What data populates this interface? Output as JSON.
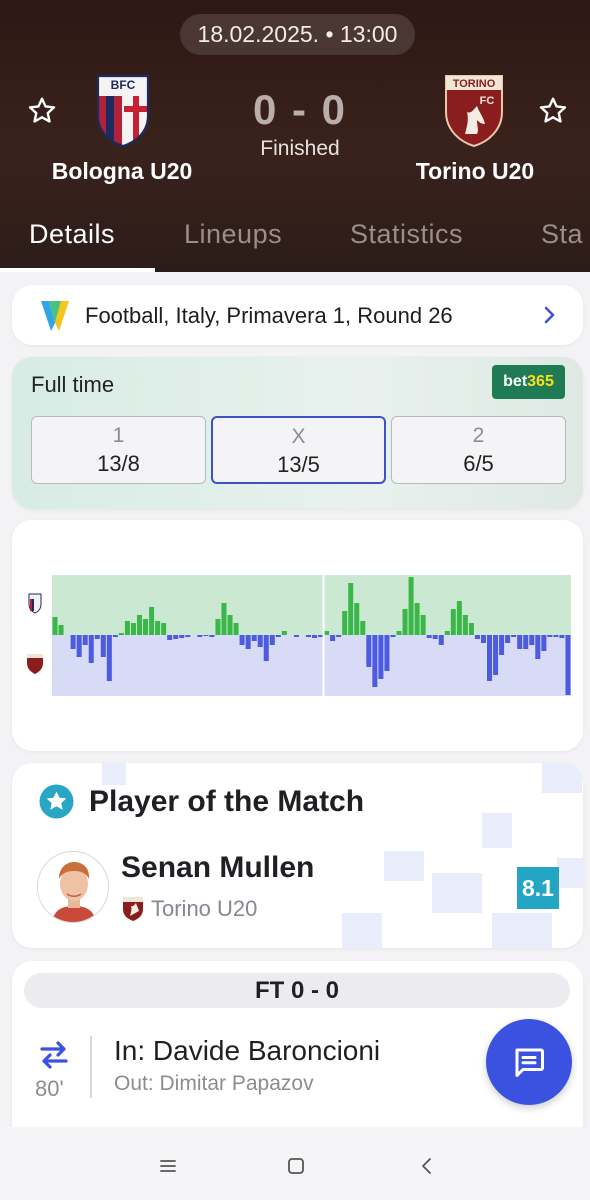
{
  "match": {
    "datetime": "18.02.2025. • 13:00",
    "home_team": "Bologna U20",
    "away_team": "Torino U20",
    "score": "0 - 0",
    "status": "Finished"
  },
  "tabs": [
    "Details",
    "Lineups",
    "Statistics",
    "Sta"
  ],
  "tournament": {
    "label": "Football, Italy, Primavera 1, Round 26"
  },
  "odds": {
    "title": "Full time",
    "bookmaker_prefix": "bet",
    "bookmaker_suffix": "365",
    "options": [
      {
        "key": "1",
        "value": "13/8"
      },
      {
        "key": "X",
        "value": "13/5"
      },
      {
        "key": "2",
        "value": "6/5"
      }
    ]
  },
  "momentum": {
    "home_color": "#3bb74a",
    "away_color": "#4c5bdf",
    "values": [
      18,
      10,
      0,
      -14,
      -22,
      -10,
      -28,
      -4,
      -22,
      -46,
      -2,
      2,
      14,
      12,
      20,
      16,
      28,
      14,
      12,
      -5,
      -4,
      -3,
      -2,
      0,
      -2,
      -1,
      -2,
      16,
      32,
      20,
      12,
      -10,
      -14,
      -6,
      -12,
      -26,
      -10,
      -2,
      4,
      0,
      -2,
      0,
      -2,
      -3,
      -2,
      4,
      -6,
      -2,
      24,
      52,
      32,
      14,
      -32,
      -52,
      -44,
      -36,
      -2,
      4,
      26,
      58,
      32,
      20,
      -3,
      -4,
      -10,
      4,
      26,
      34,
      20,
      12,
      -4,
      -8,
      -46,
      -40,
      -20,
      -8,
      -2,
      -14,
      -14,
      -10,
      -24,
      -16,
      -2,
      -2,
      -3,
      -60
    ],
    "split_index": 45
  },
  "potm": {
    "heading": "Player of the Match",
    "player": "Senan Mullen",
    "team": "Torino U20",
    "rating": "8.1",
    "rating_color": "#23a6c4"
  },
  "events": {
    "ft_label": "FT 0 - 0",
    "items": [
      {
        "minute": "80'",
        "in": "In: Davide Baroncioni",
        "out": "Out: Dimitar Papazov"
      }
    ]
  },
  "colors": {
    "header_bg": "#2e1714",
    "accent": "#3b52e0",
    "tab_active": "#ffffff"
  }
}
